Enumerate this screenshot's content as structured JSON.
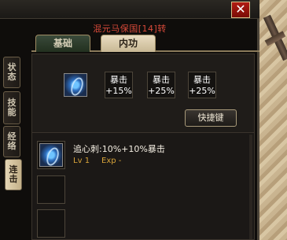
{
  "window": {
    "close_label": "✕",
    "character_title": "混元马保国[14]转"
  },
  "tabs": {
    "base": "基础",
    "neigong": "内功"
  },
  "side_tabs": [
    {
      "label": "状态",
      "active": false
    },
    {
      "label": "技能",
      "active": false
    },
    {
      "label": "经络",
      "active": false
    },
    {
      "label": "连击",
      "active": true
    }
  ],
  "bonuses": [
    {
      "name": "暴击",
      "value": "+15%"
    },
    {
      "name": "暴击",
      "value": "+25%"
    },
    {
      "name": "暴击",
      "value": "+25%"
    }
  ],
  "hotkey_label": "快捷键",
  "skills": [
    {
      "name": "追心刺:10%+10%暴击",
      "lv_label": "Lv",
      "level": "1",
      "exp_label": "Exp",
      "exp": "-"
    }
  ],
  "colors": {
    "title_red": "#d84a3a",
    "level_gold": "#d8a43a"
  }
}
